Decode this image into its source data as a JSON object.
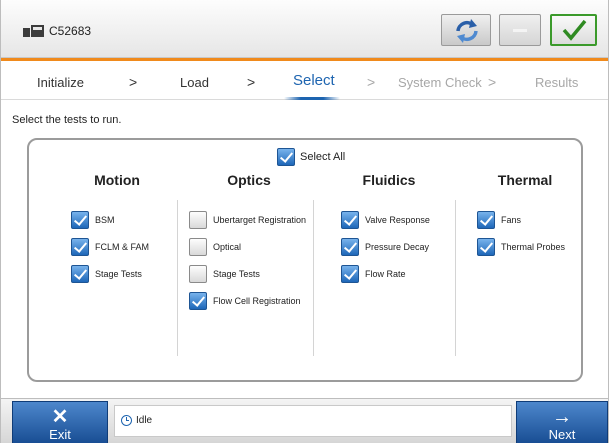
{
  "header": {
    "device_id": "C52683",
    "refresh_icon": "refresh-icon",
    "confirm_icon": "checkmark-icon"
  },
  "steps": [
    {
      "label": "Initialize",
      "state": "done"
    },
    {
      "label": "Load",
      "state": "done"
    },
    {
      "label": "Select",
      "state": "active"
    },
    {
      "label": "System Check",
      "state": "pending"
    },
    {
      "label": "Results",
      "state": "pending"
    }
  ],
  "main": {
    "instructions": "Select the tests to run.",
    "select_all": {
      "label": "Select All",
      "checked": true
    },
    "groups": [
      {
        "title": "Motion",
        "items": [
          {
            "label": "BSM",
            "checked": true
          },
          {
            "label": "FCLM & FAM",
            "checked": true
          },
          {
            "label": "Stage Tests",
            "checked": true
          }
        ]
      },
      {
        "title": "Optics",
        "items": [
          {
            "label": "Ubertarget Registration",
            "checked": false
          },
          {
            "label": "Optical",
            "checked": false
          },
          {
            "label": "Stage Tests",
            "checked": false
          },
          {
            "label": "Flow Cell Registration",
            "checked": true
          }
        ]
      },
      {
        "title": "Fluidics",
        "items": [
          {
            "label": "Valve Response",
            "checked": true
          },
          {
            "label": "Pressure Decay",
            "checked": true
          },
          {
            "label": "Flow Rate",
            "checked": true
          }
        ]
      },
      {
        "title": "Thermal",
        "items": [
          {
            "label": "Fans",
            "checked": true
          },
          {
            "label": "Thermal Probes",
            "checked": true
          }
        ]
      }
    ]
  },
  "footer": {
    "exit_label": "Exit",
    "next_label": "Next",
    "status": "Idle",
    "exit_icon": "close-icon",
    "next_icon": "arrow-right-icon"
  },
  "colors": {
    "accent": "#1d64b0",
    "progress_bar": "#f08a1c",
    "confirm": "#3b9a2b"
  }
}
